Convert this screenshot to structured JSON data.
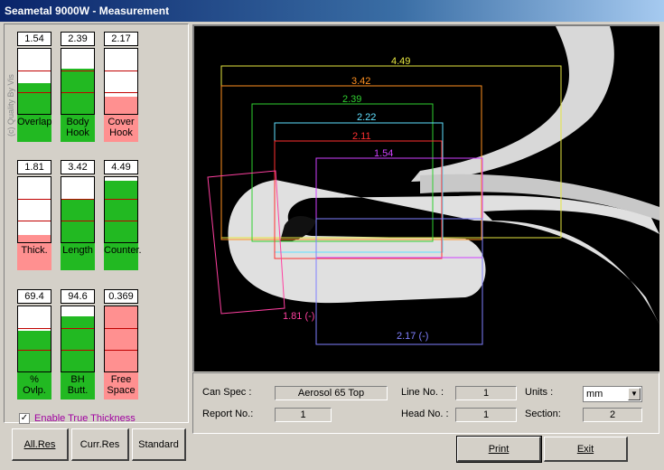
{
  "window": {
    "title": "Seametal 9000W - Measurement"
  },
  "watermark": "(c) Quality By Vis",
  "gauges": [
    {
      "value": "1.54",
      "label": "Overlap",
      "fill_fraction": 0.47,
      "fill_color": "#22b922"
    },
    {
      "value": "2.39",
      "label": "Body Hook",
      "fill_fraction": 0.7,
      "fill_color": "#22b922"
    },
    {
      "value": "2.17",
      "label": "Cover Hook",
      "fill_fraction": 0.27,
      "fill_color": "#ff9090"
    },
    {
      "value": "1.81",
      "label": "Thick.",
      "fill_fraction": 0.11,
      "fill_color": "#ff9090"
    },
    {
      "value": "3.42",
      "label": "Length",
      "fill_fraction": 0.66,
      "fill_color": "#22b922"
    },
    {
      "value": "4.49",
      "label": "Counter.",
      "fill_fraction": 0.95,
      "fill_color": "#22b922"
    },
    {
      "value": "69.4",
      "label": "% Ovlp.",
      "fill_fraction": 0.62,
      "fill_color": "#22b922"
    },
    {
      "value": "94.6",
      "label": "BH Butt.",
      "fill_fraction": 0.85,
      "fill_color": "#22b922"
    },
    {
      "value": "0.369",
      "label": "Free Space",
      "fill_fraction": 1.0,
      "fill_color": "#ff9090"
    }
  ],
  "enable_true_thickness": {
    "label": "Enable True Thickness",
    "checked": true
  },
  "buttons": {
    "all_res": "All.Res",
    "curr_res": "Curr.Res",
    "standard": "Standard",
    "print": "Print",
    "exit": "Exit"
  },
  "measurements": [
    {
      "label": "4.49",
      "color": "#e6e640"
    },
    {
      "label": "3.42",
      "color": "#ff9020"
    },
    {
      "label": "2.39",
      "color": "#30d030"
    },
    {
      "label": "2.22",
      "color": "#60e0ff"
    },
    {
      "label": "2.11",
      "color": "#ff3030"
    },
    {
      "label": "1.54",
      "color": "#d040ff"
    },
    {
      "label": "1.81 (-)",
      "color": "#ff40a0"
    },
    {
      "label": "2.17 (-)",
      "color": "#8080ff"
    }
  ],
  "info": {
    "can_spec_label": "Can Spec :",
    "can_spec_value": "Aerosol 65 Top",
    "report_no_label": "Report No.:",
    "report_no_value": "1",
    "line_no_label": "Line No. :",
    "line_no_value": "1",
    "head_no_label": "Head No. :",
    "head_no_value": "1",
    "units_label": "Units :",
    "units_value": "mm",
    "section_label": "Section:",
    "section_value": "2"
  }
}
